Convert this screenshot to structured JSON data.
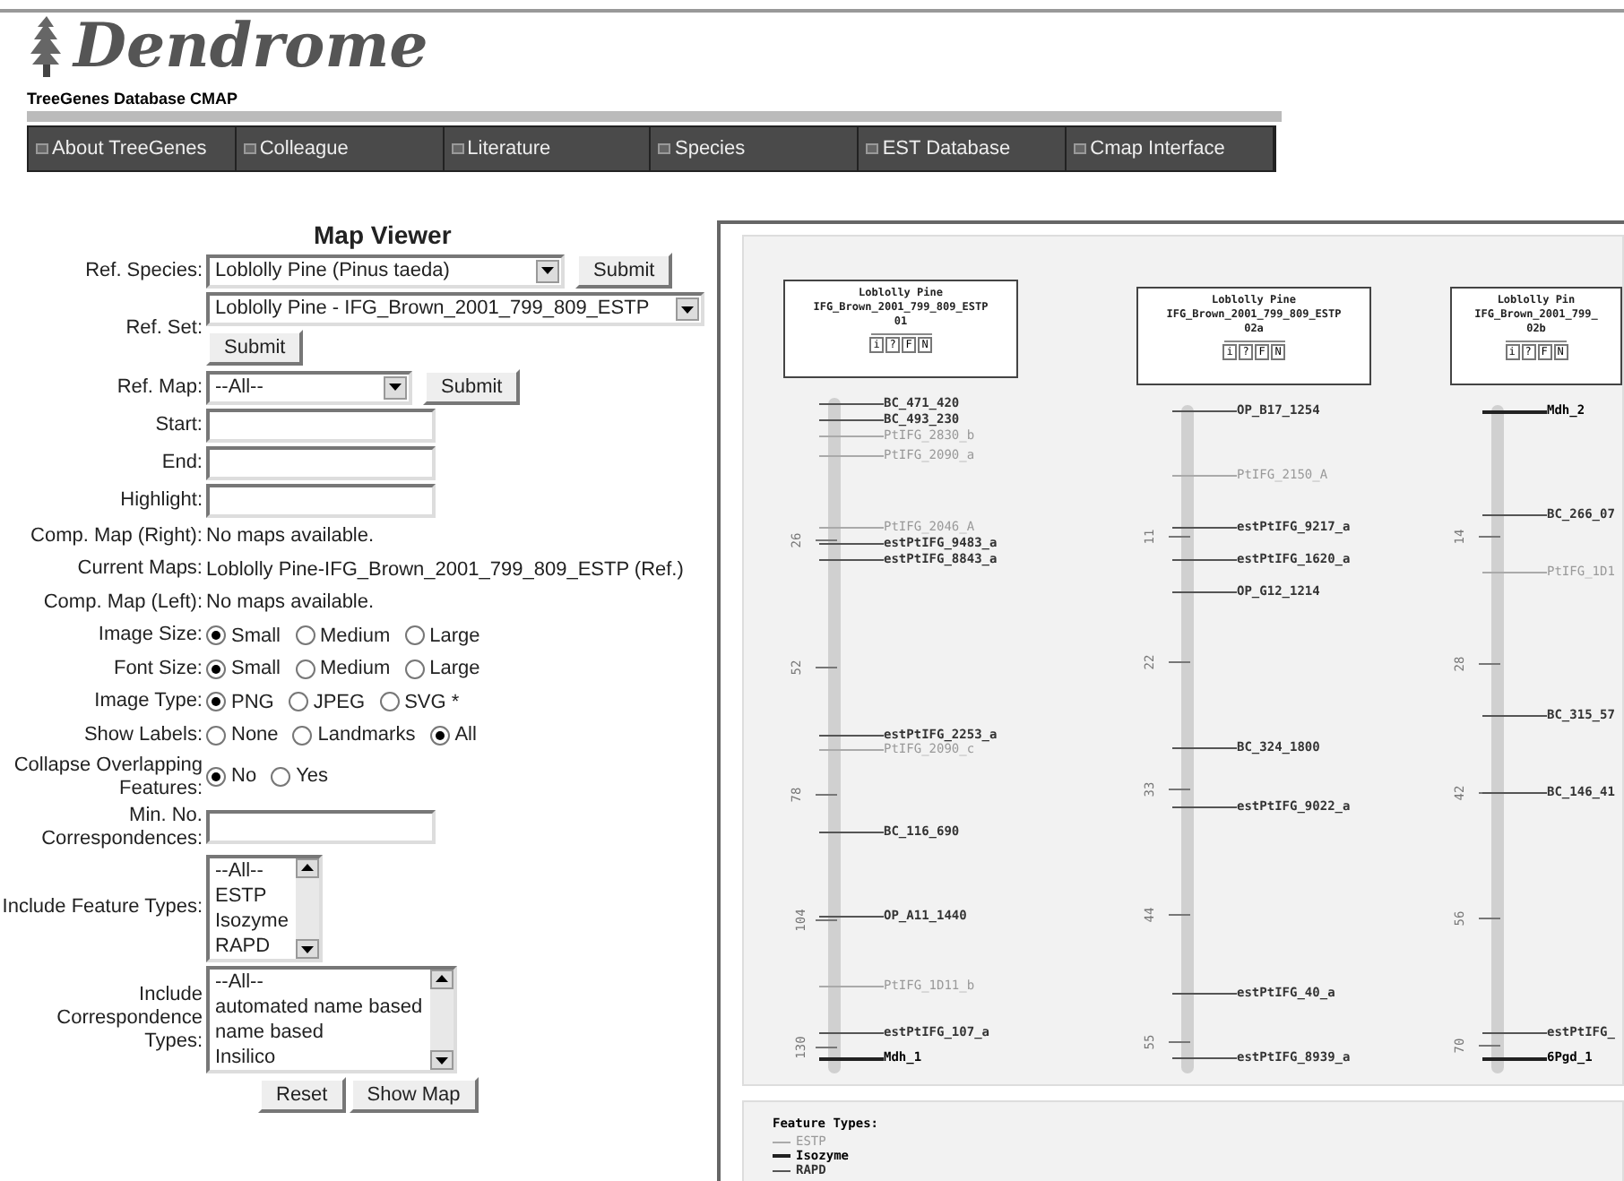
{
  "header": {
    "logo": "Dendrome",
    "subtitle": "TreeGenes Database CMAP"
  },
  "nav": [
    "About TreeGenes",
    "Colleague",
    "Literature",
    "Species",
    "EST Database",
    "Cmap Interface"
  ],
  "form": {
    "title": "Map Viewer",
    "rows": [
      {
        "kind": "select",
        "label": "Ref. Species:",
        "value": "Loblolly Pine (Pinus taeda)",
        "button": "Submit"
      },
      {
        "kind": "select_stacked",
        "label": "Ref. Set:",
        "value": "Loblolly Pine - IFG_Brown_2001_799_809_ESTP",
        "button": "Submit"
      },
      {
        "kind": "select",
        "label": "Ref. Map:",
        "value": "--All--",
        "button": "Submit"
      },
      {
        "kind": "text",
        "label": "Start:"
      },
      {
        "kind": "text",
        "label": "End:"
      },
      {
        "kind": "text",
        "label": "Highlight:"
      },
      {
        "kind": "info",
        "label": "Comp. Map (Right):",
        "value": "No maps available."
      },
      {
        "kind": "info",
        "label": "Current Maps:",
        "value": "Loblolly Pine-IFG_Brown_2001_799_809_ESTP (Ref.)"
      },
      {
        "kind": "info",
        "label": "Comp. Map (Left):",
        "value": "No maps available."
      },
      {
        "kind": "radio",
        "label": "Image Size:",
        "options": [
          {
            "label": "Small",
            "selected": true
          },
          {
            "label": "Medium",
            "selected": false
          },
          {
            "label": "Large",
            "selected": false
          }
        ]
      },
      {
        "kind": "radio",
        "label": "Font Size:",
        "options": [
          {
            "label": "Small",
            "selected": true
          },
          {
            "label": "Medium",
            "selected": false
          },
          {
            "label": "Large",
            "selected": false
          }
        ]
      },
      {
        "kind": "radio",
        "label": "Image Type:",
        "options": [
          {
            "label": "PNG",
            "selected": true
          },
          {
            "label": "JPEG",
            "selected": false
          },
          {
            "label": "SVG *",
            "selected": false
          }
        ]
      },
      {
        "kind": "radio",
        "label": "Show Labels:",
        "options": [
          {
            "label": "None",
            "selected": false
          },
          {
            "label": "Landmarks",
            "selected": false
          },
          {
            "label": "All",
            "selected": true
          }
        ]
      },
      {
        "kind": "radio",
        "label": "Collapse Overlapping Features:",
        "options": [
          {
            "label": "No",
            "selected": true
          },
          {
            "label": "Yes",
            "selected": false
          }
        ]
      },
      {
        "kind": "text",
        "label": "Min. No. Correspondences:"
      },
      {
        "kind": "listbox",
        "label": "Include Feature Types:",
        "options": [
          "--All--",
          "ESTP",
          "Isozyme",
          "RAPD"
        ]
      },
      {
        "kind": "listbox",
        "label": "Include Correspondence Types:",
        "options": [
          "--All--",
          "automated name based",
          "name based",
          "Insilico"
        ]
      }
    ],
    "buttons": [
      "Reset",
      "Show Map"
    ]
  },
  "maps": [
    {
      "title": [
        "Loblolly Pine",
        "IFG_Brown_2001_799_809_ESTP",
        "01"
      ],
      "buttons": [
        "i",
        "?",
        "F",
        "N"
      ],
      "ticks": [
        "26",
        "52",
        "78",
        "104",
        "130"
      ],
      "features": [
        {
          "label": "BC_471_420",
          "kind": "dark"
        },
        {
          "label": "BC_493_230",
          "kind": "dark"
        },
        {
          "label": "PtIFG_2830_b",
          "kind": "light"
        },
        {
          "label": "PtIFG_2090_a",
          "kind": "light"
        },
        {
          "label": "PtIFG_2046_A",
          "kind": "light"
        },
        {
          "label": "estPtIFG_9483_a",
          "kind": "dark"
        },
        {
          "label": "estPtIFG_8843_a",
          "kind": "dark"
        },
        {
          "label": "estPtIFG_2253_a",
          "kind": "dark"
        },
        {
          "label": "PtIFG_2090_c",
          "kind": "light"
        },
        {
          "label": "BC_116_690",
          "kind": "dark"
        },
        {
          "label": "OP_A11_1440",
          "kind": "dark"
        },
        {
          "label": "PtIFG_1D11_b",
          "kind": "light"
        },
        {
          "label": "estPtIFG_107_a",
          "kind": "dark"
        },
        {
          "label": "Mdh_1",
          "kind": "bold"
        }
      ]
    },
    {
      "title": [
        "Loblolly Pine",
        "IFG_Brown_2001_799_809_ESTP",
        "02a"
      ],
      "buttons": [
        "i",
        "?",
        "F",
        "N"
      ],
      "ticks": [
        "11",
        "22",
        "33",
        "44",
        "55"
      ],
      "features": [
        {
          "label": "OP_B17_1254",
          "kind": "dark"
        },
        {
          "label": "PtIFG_2150_A",
          "kind": "light"
        },
        {
          "label": "estPtIFG_9217_a",
          "kind": "dark"
        },
        {
          "label": "estPtIFG_1620_a",
          "kind": "dark"
        },
        {
          "label": "OP_G12_1214",
          "kind": "dark"
        },
        {
          "label": "BC_324_1800",
          "kind": "dark"
        },
        {
          "label": "estPtIFG_9022_a",
          "kind": "dark"
        },
        {
          "label": "estPtIFG_40_a",
          "kind": "dark"
        },
        {
          "label": "estPtIFG_8939_a",
          "kind": "dark"
        }
      ]
    },
    {
      "title": [
        "Loblolly Pin",
        "IFG_Brown_2001_799_",
        "02b"
      ],
      "buttons": [
        "i",
        "?",
        "F",
        "N"
      ],
      "ticks": [
        "14",
        "28",
        "42",
        "56",
        "70"
      ],
      "features": [
        {
          "label": "Mdh_2",
          "kind": "bold"
        },
        {
          "label": "BC_266_07",
          "kind": "dark"
        },
        {
          "label": "PtIFG_1D1",
          "kind": "light"
        },
        {
          "label": "BC_315_57",
          "kind": "dark"
        },
        {
          "label": "BC_146_41",
          "kind": "dark"
        },
        {
          "label": "estPtIFG_",
          "kind": "dark"
        },
        {
          "label": "6Pgd_1",
          "kind": "bold"
        }
      ]
    }
  ],
  "legend": {
    "title": "Feature Types:",
    "items": [
      {
        "label": "ESTP",
        "kind": "light"
      },
      {
        "label": "Isozyme",
        "kind": "bold"
      },
      {
        "label": "RAPD",
        "kind": "dark"
      }
    ]
  }
}
